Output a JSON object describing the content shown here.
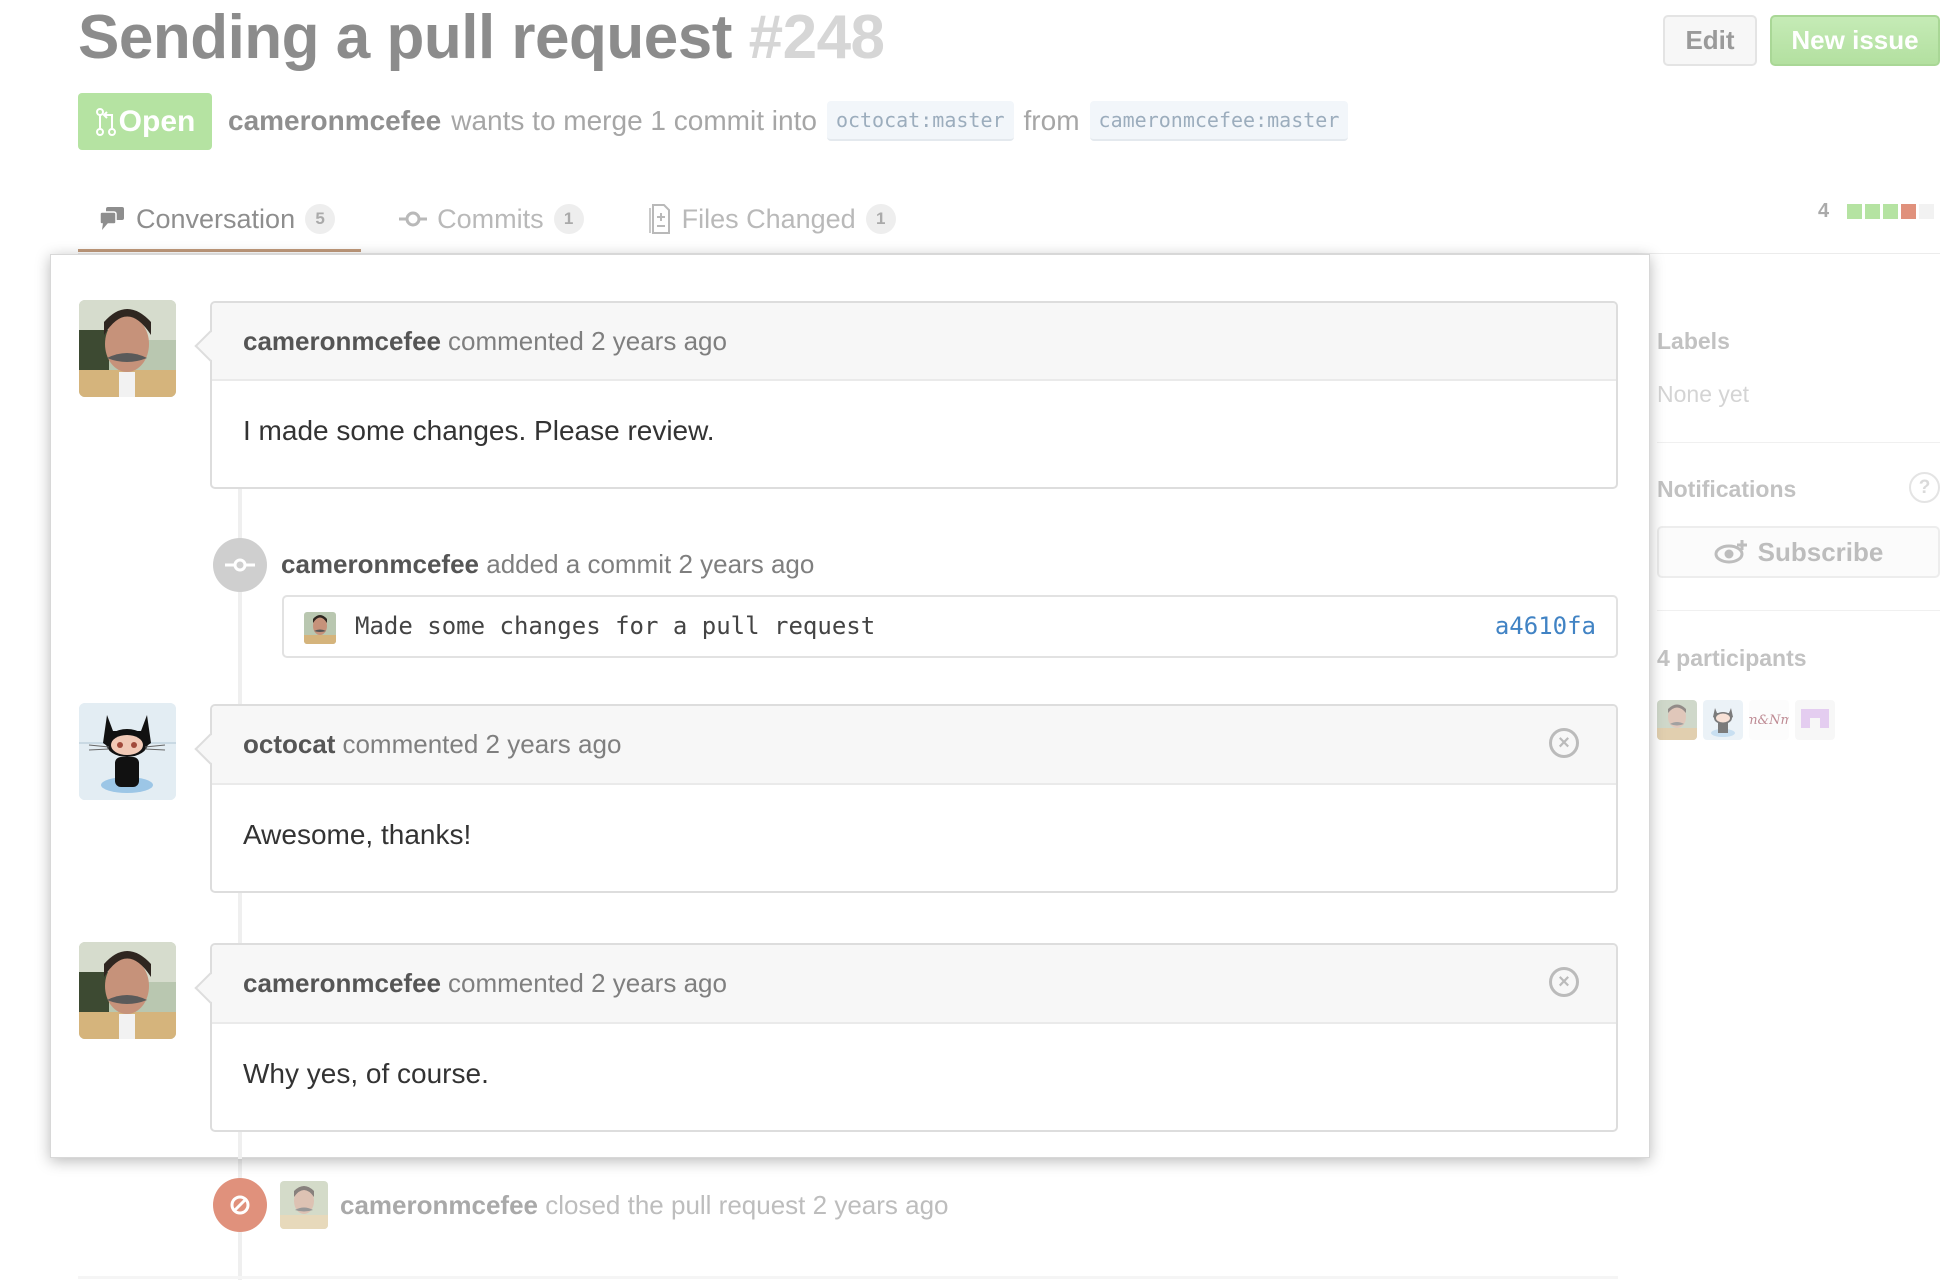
{
  "header": {
    "title": "Sending a pull request",
    "number": "#248",
    "edit_label": "Edit",
    "new_issue_label": "New issue",
    "state_label": "Open",
    "state_icon": "git-pull-request-icon",
    "author": "cameronmcefee",
    "merge_text": "wants to merge 1 commit into",
    "base_ref_user": "octocat",
    "base_ref_branch": "master",
    "from_text": "from",
    "head_ref_user": "cameronmcefee",
    "head_ref_branch": "master"
  },
  "tabs": [
    {
      "label": "Conversation",
      "count": "5",
      "icon": "comment-discussion-icon",
      "active": true
    },
    {
      "label": "Commits",
      "count": "1",
      "icon": "git-commit-icon",
      "active": false
    },
    {
      "label": "Files Changed",
      "count": "1",
      "icon": "diff-icon",
      "active": false
    }
  ],
  "diffstat": {
    "count": "4",
    "blocks": [
      "#b5e3a2",
      "#b5e3a2",
      "#b5e3a2",
      "#e0917c",
      "#f2f2f2"
    ]
  },
  "sidebar": {
    "labels_heading": "Labels",
    "labels_value": "None yet",
    "notifications_heading": "Notifications",
    "help_glyph": "?",
    "subscribe_label": "Subscribe",
    "participants_heading": "4 participants",
    "participants": [
      "cameronmcefee",
      "octocat",
      "m&Nm",
      "identicon"
    ]
  },
  "timeline": {
    "comments": [
      {
        "author": "cameronmcefee",
        "action": "commented",
        "time": "2 years ago",
        "body": "I made some changes. Please review.",
        "avatar": "cameronmcefee",
        "deletable": false
      },
      {
        "author": "octocat",
        "action": "commented",
        "time": "2 years ago",
        "body": "Awesome, thanks!",
        "avatar": "octocat",
        "deletable": true
      },
      {
        "author": "cameronmcefee",
        "action": "commented",
        "time": "2 years ago",
        "body": "Why yes, of course.",
        "avatar": "cameronmcefee",
        "deletable": true
      }
    ],
    "commit_event": {
      "author": "cameronmcefee",
      "action": "added a commit",
      "time": "2 years ago",
      "message": "Made some changes for a pull request",
      "sha": "a4610fa"
    },
    "closed_event": {
      "author": "cameronmcefee",
      "action": "closed the pull request",
      "time": "2 years ago"
    }
  },
  "colors": {
    "open_green": "#b5e3a2",
    "closed_red": "#e0917c",
    "link_blue": "#4183c4",
    "tab_accent": "#c19a7c"
  }
}
